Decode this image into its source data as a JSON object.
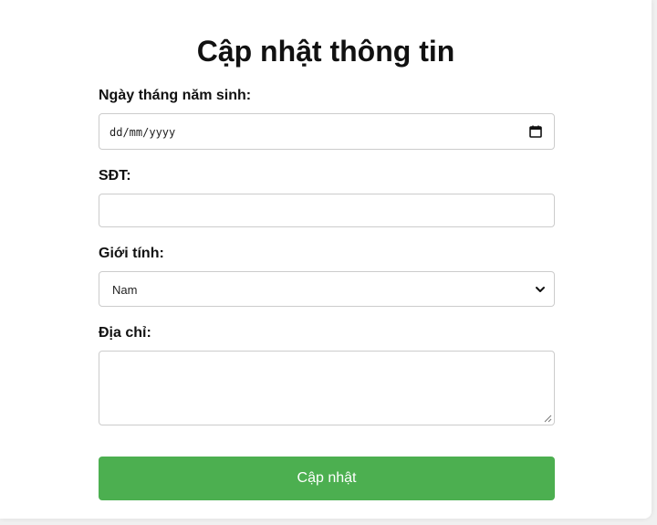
{
  "form": {
    "title": "Cập nhật thông tin",
    "birthdate": {
      "label": "Ngày tháng năm sinh:",
      "placeholder": "dd/mm/yyyy",
      "icon": "calendar-icon"
    },
    "phone": {
      "label": "SĐT:",
      "value": ""
    },
    "gender": {
      "label": "Giới tính:",
      "selected": "Nam",
      "icon": "chevron-down-icon"
    },
    "address": {
      "label": "Địa chỉ:",
      "value": ""
    },
    "submit_label": "Cập nhật"
  },
  "colors": {
    "accent": "#4caf50",
    "border": "#cccccc",
    "background": "#f0f0f0"
  }
}
